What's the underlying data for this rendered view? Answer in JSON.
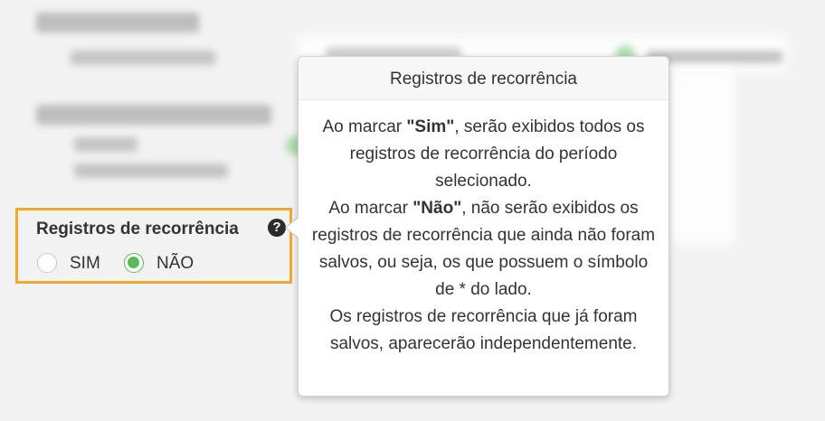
{
  "option": {
    "title": "Registros de recorrência",
    "help_icon": "question-circle-icon",
    "options": [
      {
        "label": "SIM",
        "checked": false
      },
      {
        "label": "NÃO",
        "checked": true
      }
    ]
  },
  "tooltip": {
    "title": "Registros de recorrência",
    "p1_a": "Ao marcar ",
    "p1_b": "\"Sim\"",
    "p1_c": ", serão exibidos todos os registros de recorrência do período selecionado.",
    "p2_a": "Ao marcar ",
    "p2_b": "\"Não\"",
    "p2_c": ", não serão exibidos os registros de recorrência que ainda não foram salvos, ou seja, os que possuem o símbolo de * do lado.",
    "p3": "Os registros de recorrência que já foram salvos, aparecerão independentemente."
  },
  "colors": {
    "highlight": "#f0a92c",
    "radio_checked": "#5cb85c"
  }
}
